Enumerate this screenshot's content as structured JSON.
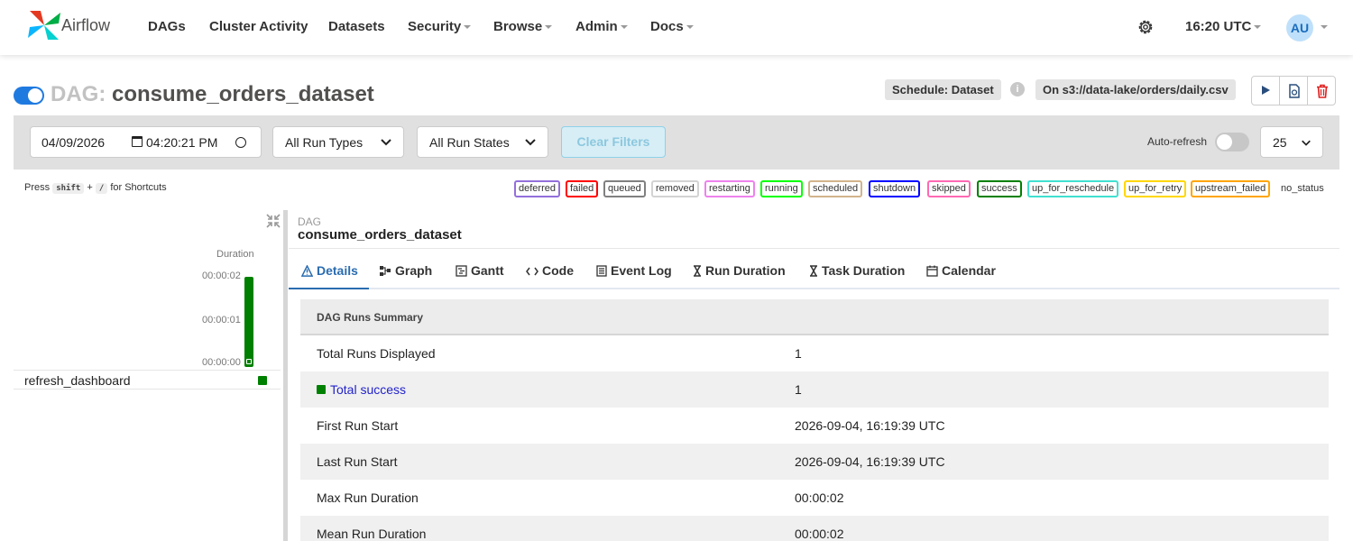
{
  "nav": {
    "logo_text": "Airflow",
    "items": [
      {
        "label": "DAGs",
        "dropdown": false
      },
      {
        "label": "Cluster Activity",
        "dropdown": false
      },
      {
        "label": "Datasets",
        "dropdown": false
      },
      {
        "label": "Security",
        "dropdown": true
      },
      {
        "label": "Browse",
        "dropdown": true
      },
      {
        "label": "Admin",
        "dropdown": true
      },
      {
        "label": "Docs",
        "dropdown": true
      }
    ],
    "time": "16:20 UTC",
    "avatar": "AU",
    "icons": {
      "settings": "gear-icon"
    }
  },
  "dag": {
    "prefix": "DAG:",
    "id": "consume_orders_dataset",
    "schedule_label": "Schedule: Dataset",
    "schedule_value": "On s3://data-lake/orders/daily.csv",
    "paused": false
  },
  "filters": {
    "date": "04/09/2026",
    "time": "04:20:21 PM",
    "run_type": "All Run Types",
    "run_state": "All Run States",
    "clear_label": "Clear Filters",
    "autorefresh_label": "Auto-refresh",
    "autorefresh_on": false,
    "num_runs": "25"
  },
  "shortcuts": {
    "press": "Press",
    "key1": "shift",
    "plus": "+",
    "key2": "/",
    "suffix": "for Shortcuts"
  },
  "legend": [
    {
      "label": "deferred",
      "color": "#9370db"
    },
    {
      "label": "failed",
      "color": "#ff0000"
    },
    {
      "label": "queued",
      "color": "#808080"
    },
    {
      "label": "removed",
      "color": "#d3d3d3"
    },
    {
      "label": "restarting",
      "color": "#ee82ee"
    },
    {
      "label": "running",
      "color": "#00ff00"
    },
    {
      "label": "scheduled",
      "color": "#d2b48c"
    },
    {
      "label": "shutdown",
      "color": "#0000ff"
    },
    {
      "label": "skipped",
      "color": "#ff69b4"
    },
    {
      "label": "success",
      "color": "#008000"
    },
    {
      "label": "up_for_reschedule",
      "color": "#40e0d0"
    },
    {
      "label": "up_for_retry",
      "color": "#ffd700"
    },
    {
      "label": "upstream_failed",
      "color": "#ffa500"
    }
  ],
  "legend_no_status": "no_status",
  "grid": {
    "duration_label": "Duration",
    "ticks": [
      "00:00:02",
      "00:00:01",
      "00:00:00"
    ],
    "task": "refresh_dashboard",
    "run_state_color": "#008000"
  },
  "details": {
    "section_label": "DAG",
    "dag_id": "consume_orders_dataset",
    "tabs": [
      "Details",
      "Graph",
      "Gantt",
      "Code",
      "Event Log",
      "Run Duration",
      "Task Duration",
      "Calendar"
    ],
    "active_tab": "Details",
    "summary_title": "DAG Runs Summary",
    "rows": [
      {
        "key": "Total Runs Displayed",
        "value": "1"
      },
      {
        "key": "Total success",
        "value": "1"
      },
      {
        "key": "First Run Start",
        "value": "2026-09-04, 16:19:39 UTC"
      },
      {
        "key": "Last Run Start",
        "value": "2026-09-04, 16:19:39 UTC"
      },
      {
        "key": "Max Run Duration",
        "value": "00:00:02"
      },
      {
        "key": "Mean Run Duration",
        "value": "00:00:02"
      }
    ]
  }
}
